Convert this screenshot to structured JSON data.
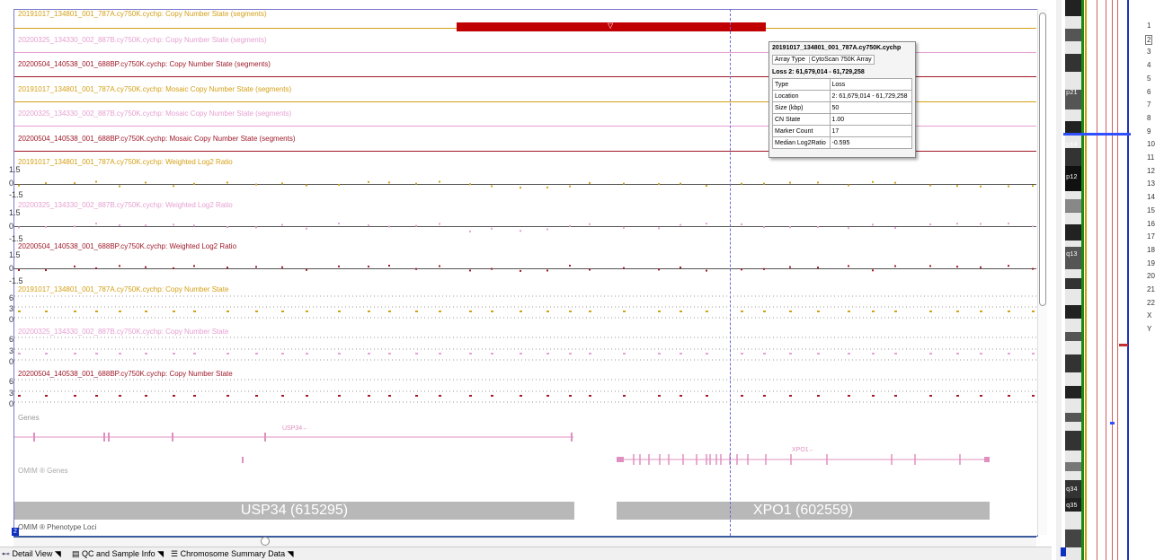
{
  "tracks": {
    "cns_seg_a": "20191017_134801_001_787A.cy750K.cychp: Copy Number State (segments)",
    "cns_seg_b": "20200325_134330_002_887B.cy750K.cychp: Copy Number State (segments)",
    "cns_seg_c": "20200504_140538_001_688BP.cy750K.cychp: Copy Number State (segments)",
    "mos_seg_a": "20191017_134801_001_787A.cy750K.cychp: Mosaic Copy Number State (segments)",
    "mos_seg_b": "20200325_134330_002_887B.cy750K.cychp: Mosaic Copy Number State (segments)",
    "mos_seg_c": "20200504_140538_001_688BP.cy750K.cychp: Mosaic Copy Number State (segments)",
    "wlr_a": "20191017_134801_001_787A.cy750K.cychp: Weighted Log2 Ratio",
    "wlr_b": "20200325_134330_002_887B.cy750K.cychp: Weighted Log2 Ratio",
    "wlr_c": "20200504_140538_001_688BP.cy750K.cychp: Weighted Log2 Ratio",
    "cn_a": "20191017_134801_001_787A.cy750K.cychp: Copy Number State",
    "cn_b": "20200325_134330_002_887B.cy750K.cychp: Copy Number State",
    "cn_c": "20200504_140538_001_688BP.cy750K.cychp: Copy Number State",
    "genes": "Genes",
    "omim_genes": "OMIM ® Genes",
    "omim_pheno": "OMIM ® Phenotype Loci"
  },
  "axis": {
    "top": "1.5",
    "zero": "0",
    "bottom": "-1.5",
    "cn6": "6",
    "cn3": "3",
    "cn0": "0"
  },
  "genes": {
    "usp34": "USP34←",
    "xpo1": "XPO1←"
  },
  "omim": {
    "usp34": "USP34 (615295)",
    "xpo1": "XPO1 (602559)"
  },
  "tooltip": {
    "file": "20191017_134801_001_787A.cy750K.cychp",
    "array_type_label": "Array Type",
    "array_type_value": "CytoScan 750K Array",
    "title": "Loss 2: 61,679,014 - 61,729,258",
    "rows": [
      {
        "k": "Type",
        "v": "Loss"
      },
      {
        "k": "Location",
        "v": "2: 61,679,014 - 61,729,258"
      },
      {
        "k": "Size (kbp)",
        "v": "50"
      },
      {
        "k": "CN State",
        "v": "1.00"
      },
      {
        "k": "Marker Count",
        "v": "17"
      },
      {
        "k": "Median Log2Ratio",
        "v": "-0.595"
      }
    ]
  },
  "tabs": {
    "detail": "Detail View",
    "qc": "QC and Sample Info",
    "summary": "Chromosome Summary Data"
  },
  "ideogram": {
    "bands": [
      "p21",
      "p14",
      "p12",
      "q13",
      "q34",
      "q35"
    ],
    "chromosome_badge": "2"
  },
  "chromosomes": [
    "1",
    "2",
    "3",
    "4",
    "5",
    "6",
    "7",
    "8",
    "9",
    "10",
    "11",
    "12",
    "13",
    "14",
    "15",
    "16",
    "17",
    "18",
    "19",
    "20",
    "21",
    "22",
    "X",
    "Y"
  ],
  "colors": {
    "sample_a": "#d4a017",
    "sample_b": "#e6a0d2",
    "sample_c": "#a01a2a",
    "loss_segment": "#c00000",
    "gene": "#e090c0",
    "omim_bar": "#b8b8b8"
  }
}
